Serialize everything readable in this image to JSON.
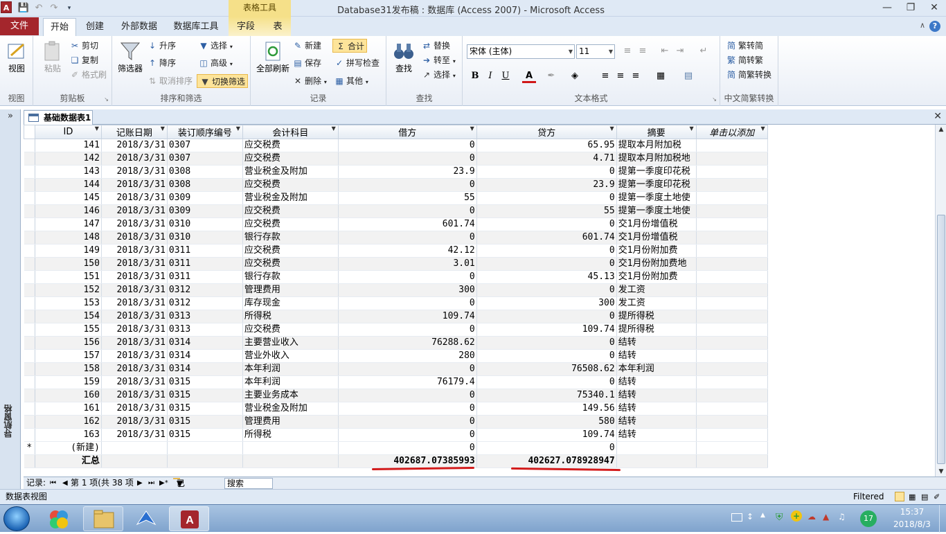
{
  "title": {
    "app_icon": "A",
    "context_tab": "表格工具",
    "window_title": "Database31发布稿 : 数据库 (Access 2007) - Microsoft Access"
  },
  "tabs": {
    "file": "文件",
    "home": "开始",
    "create": "创建",
    "external": "外部数据",
    "dbtools": "数据库工具",
    "fields": "字段",
    "table": "表"
  },
  "ribbon": {
    "view": {
      "btn": "视图",
      "group": "视图"
    },
    "clipboard": {
      "paste": "粘贴",
      "cut": "剪切",
      "copy": "复制",
      "format_painter": "格式刷",
      "group": "剪贴板"
    },
    "sort": {
      "filter": "筛选器",
      "asc": "升序",
      "desc": "降序",
      "remove_sort": "取消排序",
      "selection": "选择",
      "advanced": "高级",
      "toggle_filter": "切换筛选",
      "group": "排序和筛选"
    },
    "records": {
      "refresh": "全部刷新",
      "new": "新建",
      "save": "保存",
      "delete": "删除",
      "totals": "合计",
      "spelling": "拼写检查",
      "more": "其他",
      "group": "记录"
    },
    "find": {
      "find": "查找",
      "replace": "替换",
      "goto": "转至",
      "select": "选择",
      "group": "查找"
    },
    "text": {
      "font": "宋体 (主体)",
      "size": "11",
      "group": "文本格式"
    },
    "chinese": {
      "to_trad": "繁转简",
      "to_simp": "简转繁",
      "convert": "简繁转换",
      "group": "中文简繁转换"
    }
  },
  "doc_tab": "基础数据表1",
  "nav_pane_label": "导航窗格",
  "columns": [
    "ID",
    "记账日期",
    "装订顺序编号",
    "会计科目",
    "借方",
    "贷方",
    "摘要",
    "单击以添加"
  ],
  "rows": [
    [
      "141",
      "2018/3/31",
      "0307",
      "应交税费",
      "0",
      "65.95",
      "提取本月附加税"
    ],
    [
      "142",
      "2018/3/31",
      "0307",
      "应交税费",
      "0",
      "4.71",
      "提取本月附加税地"
    ],
    [
      "143",
      "2018/3/31",
      "0308",
      "营业税金及附加",
      "23.9",
      "0",
      "提第一季度印花税"
    ],
    [
      "144",
      "2018/3/31",
      "0308",
      "应交税费",
      "0",
      "23.9",
      "提第一季度印花税"
    ],
    [
      "145",
      "2018/3/31",
      "0309",
      "营业税金及附加",
      "55",
      "0",
      "提第一季度土地使"
    ],
    [
      "146",
      "2018/3/31",
      "0309",
      "应交税费",
      "0",
      "55",
      "提第一季度土地使"
    ],
    [
      "147",
      "2018/3/31",
      "0310",
      "应交税费",
      "601.74",
      "0",
      "交1月份增值税"
    ],
    [
      "148",
      "2018/3/31",
      "0310",
      "银行存款",
      "0",
      "601.74",
      "交1月份增值税"
    ],
    [
      "149",
      "2018/3/31",
      "0311",
      "应交税费",
      "42.12",
      "0",
      "交1月份附加费"
    ],
    [
      "150",
      "2018/3/31",
      "0311",
      "应交税费",
      "3.01",
      "0",
      "交1月份附加费地"
    ],
    [
      "151",
      "2018/3/31",
      "0311",
      "银行存款",
      "0",
      "45.13",
      "交1月份附加费"
    ],
    [
      "152",
      "2018/3/31",
      "0312",
      "管理费用",
      "300",
      "0",
      "发工资"
    ],
    [
      "153",
      "2018/3/31",
      "0312",
      "库存现金",
      "0",
      "300",
      "发工资"
    ],
    [
      "154",
      "2018/3/31",
      "0313",
      "所得税",
      "109.74",
      "0",
      "提所得税"
    ],
    [
      "155",
      "2018/3/31",
      "0313",
      "应交税费",
      "0",
      "109.74",
      "提所得税"
    ],
    [
      "156",
      "2018/3/31",
      "0314",
      "主要营业收入",
      "76288.62",
      "0",
      "结转"
    ],
    [
      "157",
      "2018/3/31",
      "0314",
      "营业外收入",
      "280",
      "0",
      "结转"
    ],
    [
      "158",
      "2018/3/31",
      "0314",
      "本年利润",
      "0",
      "76508.62",
      "本年利润"
    ],
    [
      "159",
      "2018/3/31",
      "0315",
      "本年利润",
      "76179.4",
      "0",
      "结转"
    ],
    [
      "160",
      "2018/3/31",
      "0315",
      "主要业务成本",
      "0",
      "75340.1",
      "结转"
    ],
    [
      "161",
      "2018/3/31",
      "0315",
      "营业税金及附加",
      "0",
      "149.56",
      "结转"
    ],
    [
      "162",
      "2018/3/31",
      "0315",
      "管理费用",
      "0",
      "580",
      "结转"
    ],
    [
      "163",
      "2018/3/31",
      "0315",
      "所得税",
      "0",
      "109.74",
      "结转"
    ]
  ],
  "new_row": {
    "marker": "*",
    "label": "(新建)",
    "debit": "0",
    "credit": "0"
  },
  "total_row": {
    "label": "汇总",
    "debit": "402687.07385993",
    "credit": "402627.078928947"
  },
  "record_nav": {
    "label": "记录:",
    "position": "第 1 项(共 38 项",
    "filter": "已筛选",
    "search": "搜索"
  },
  "status": {
    "left": "数据表视图",
    "right": "Filtered"
  },
  "taskbar": {
    "time": "15:37",
    "date": "2018/8/3",
    "badge": "17"
  }
}
